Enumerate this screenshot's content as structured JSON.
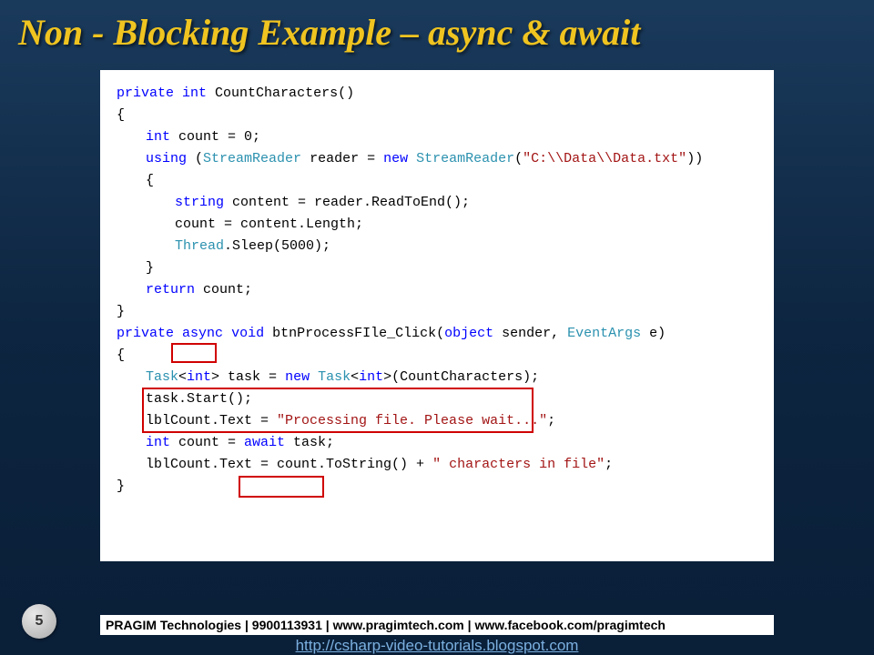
{
  "title": "Non - Blocking Example – async & await",
  "code": {
    "l1_private": "private",
    "l1_int": "int",
    "l1_method": " CountCharacters()",
    "l2_brace": "{",
    "l3_int": "int",
    "l3_rest": " count = 0;",
    "l4_using": "using",
    "l4_p1": " (",
    "l4_sr": "StreamReader",
    "l4_reader": " reader = ",
    "l4_new": "new",
    "l4_sp": " ",
    "l4_sr2": "StreamReader",
    "l4_p2": "(",
    "l4_str": "\"C:\\\\Data\\\\Data.txt\"",
    "l4_p3": "))",
    "l5_brace": "{",
    "l6_string": "string",
    "l6_rest": " content = reader.ReadToEnd();",
    "l7": "count = content.Length;",
    "l8_thread": "Thread",
    "l8_rest": ".Sleep(5000);",
    "l9_brace": "}",
    "l10_return": "return",
    "l10_rest": " count;",
    "l11_brace": "}",
    "l12_blank": "",
    "l13_private": "private",
    "l13_sp1": " ",
    "l13_async": "async",
    "l13_sp2": " ",
    "l13_void": "void",
    "l13_method": " btnProcessFIle_Click(",
    "l13_object": "object",
    "l13_sender": " sender, ",
    "l13_eventargs": "EventArgs",
    "l13_e": " e)",
    "l14_brace": "{",
    "l15_task": "Task",
    "l15_lt": "<",
    "l15_int1": "int",
    "l15_gt": "> task = ",
    "l15_new": "new",
    "l15_sp": " ",
    "l15_task2": "Task",
    "l15_lt2": "<",
    "l15_int2": "int",
    "l15_gt2": ">(CountCharacters);",
    "l16": "task.Start();",
    "l17_blank": "",
    "l18_lbl": "lblCount.Text = ",
    "l18_str": "\"Processing file. Please wait...\"",
    "l18_semi": ";",
    "l19_int": "int",
    "l19_count": " count = ",
    "l19_await": "await",
    "l19_task": " task;",
    "l20_lbl": "lblCount.Text = count.ToString() + ",
    "l20_str": "\" characters in file\"",
    "l20_semi": ";",
    "l21_brace": "}"
  },
  "footer": "PRAGIM Technologies | 9900113931 | www.pragimtech.com | www.facebook.com/pragimtech",
  "link": "http://csharp-video-tutorials.blogspot.com",
  "pageNum": "5"
}
